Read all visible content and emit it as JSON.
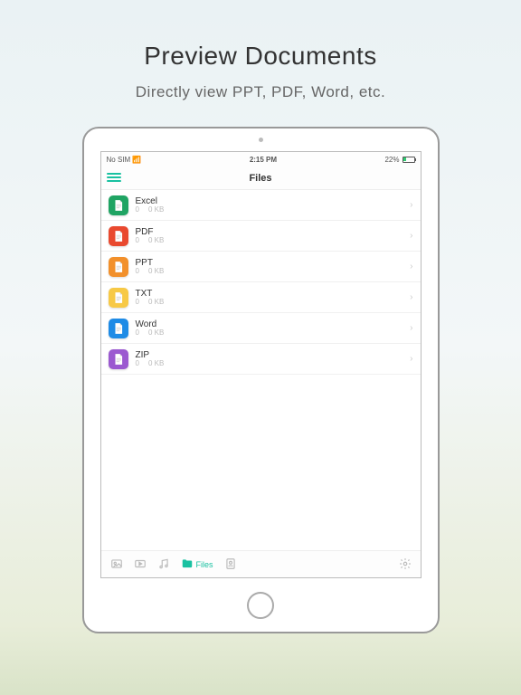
{
  "hero": {
    "title": "Preview Documents",
    "subtitle": "Directly view PPT, PDF, Word, etc."
  },
  "statusbar": {
    "carrier": "No SIM",
    "time": "2:15 PM",
    "battery_pct": "22%"
  },
  "navbar": {
    "title": "Files"
  },
  "files": [
    {
      "name": "Excel",
      "count": "0",
      "size": "0 KB",
      "color": "#1fa463",
      "icon": "excel"
    },
    {
      "name": "PDF",
      "count": "0",
      "size": "0 KB",
      "color": "#e9492f",
      "icon": "pdf"
    },
    {
      "name": "PPT",
      "count": "0",
      "size": "0 KB",
      "color": "#f2902b",
      "icon": "ppt"
    },
    {
      "name": "TXT",
      "count": "0",
      "size": "0 KB",
      "color": "#f7c946",
      "icon": "txt"
    },
    {
      "name": "Word",
      "count": "0",
      "size": "0 KB",
      "color": "#1e8be6",
      "icon": "word"
    },
    {
      "name": "ZIP",
      "count": "0",
      "size": "0 KB",
      "color": "#9b59d0",
      "icon": "zip"
    }
  ],
  "toolbar": {
    "items": [
      {
        "icon": "photo",
        "label": ""
      },
      {
        "icon": "video",
        "label": ""
      },
      {
        "icon": "music",
        "label": ""
      },
      {
        "icon": "folder",
        "label": "Files",
        "active": true
      },
      {
        "icon": "contact",
        "label": ""
      }
    ],
    "right_icon": "settings"
  }
}
